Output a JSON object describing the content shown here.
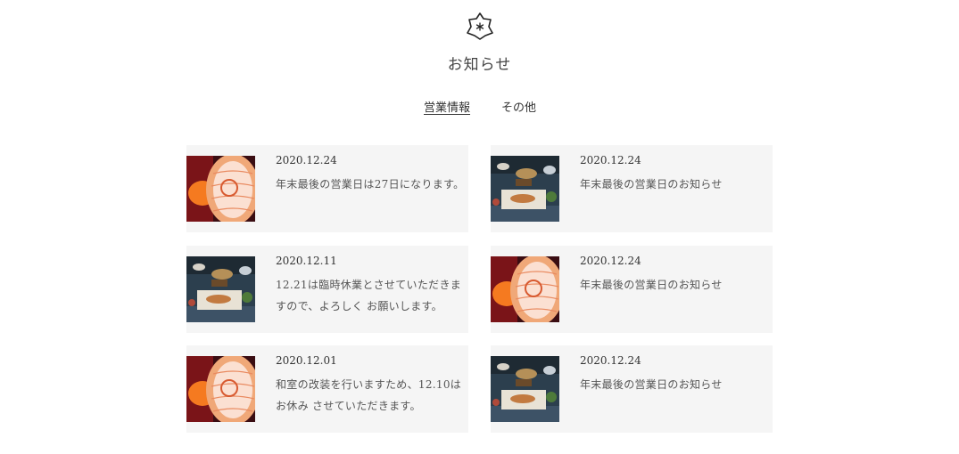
{
  "page": {
    "title": "お知らせ"
  },
  "tabs": [
    {
      "label": "営業情報",
      "active": true
    },
    {
      "label": "その他",
      "active": false
    }
  ],
  "news": [
    {
      "date": "2020.12.24",
      "text": "年末最後の営業日は27日になります。",
      "image": "lantern"
    },
    {
      "date": "2020.12.24",
      "text": "年末最後の営業日のお知らせ",
      "image": "dishes"
    },
    {
      "date": "2020.12.11",
      "text": "12.21は臨時休業とさせていただきますので、よろしく お願いします。",
      "image": "dishes"
    },
    {
      "date": "2020.12.24",
      "text": "年末最後の営業日のお知らせ",
      "image": "lantern"
    },
    {
      "date": "2020.12.01",
      "text": "和室の改装を行いますため、12.10はお休み させていただきます。",
      "image": "lantern"
    },
    {
      "date": "2020.12.24",
      "text": "年末最後の営業日のお知らせ",
      "image": "dishes"
    }
  ]
}
